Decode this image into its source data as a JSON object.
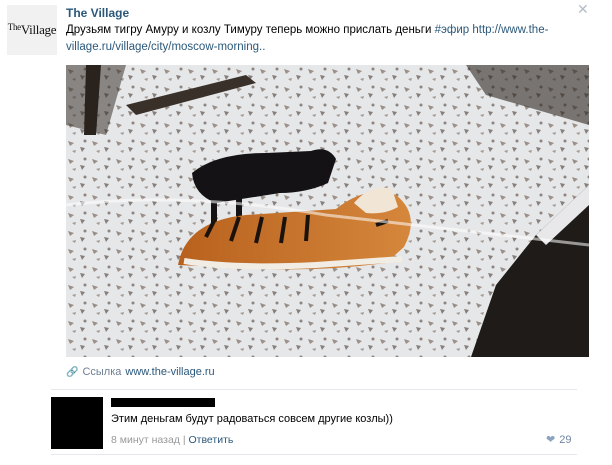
{
  "post": {
    "author": "The Village",
    "logo_text": "Village",
    "text_main": "Друзьям тигру Амуру и козлу Тимуру теперь можно прислать деньги ",
    "hashtag": "#эфир",
    "url": "http://www.the-village.ru/village/city/moscow-morning..",
    "link_label": "Ссылка",
    "link_domain": "www.the-village.ru"
  },
  "comment": {
    "text": "Этим деньгам будут радоваться совсем другие козлы))",
    "time": "8 минут назад",
    "divider": "|",
    "reply": "Ответить",
    "likes": "29"
  },
  "icons": {
    "close": "close-icon",
    "link": "link-icon",
    "like": "heart-icon"
  }
}
